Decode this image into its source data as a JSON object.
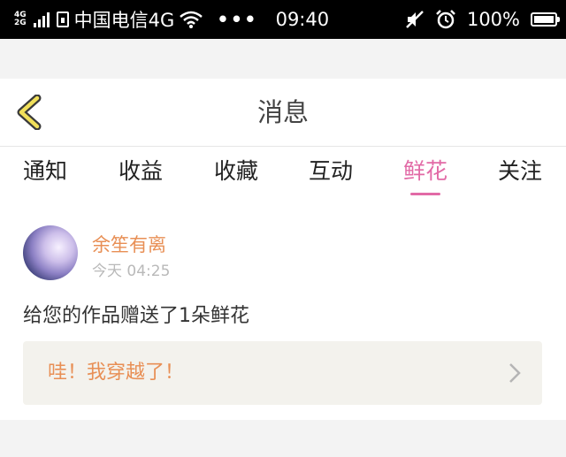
{
  "status_bar": {
    "network_top": "4G",
    "network_bottom": "2G",
    "carrier": "中国电信4G",
    "dots": "•••",
    "time": "09:40",
    "battery": "100%"
  },
  "header": {
    "title": "消息"
  },
  "tabs": [
    {
      "label": "通知",
      "active": false
    },
    {
      "label": "收益",
      "active": false
    },
    {
      "label": "收藏",
      "active": false
    },
    {
      "label": "互动",
      "active": false
    },
    {
      "label": "鲜花",
      "active": true
    },
    {
      "label": "关注",
      "active": false
    }
  ],
  "message": {
    "username": "余笙有离",
    "time": "今天 04:25",
    "text": "给您的作品赠送了1朵鲜花",
    "work_title": "哇！我穿越了！"
  },
  "colors": {
    "accent_pink": "#e26aa6",
    "accent_orange": "#e88f55",
    "back_icon_fill": "#f1e05a"
  }
}
